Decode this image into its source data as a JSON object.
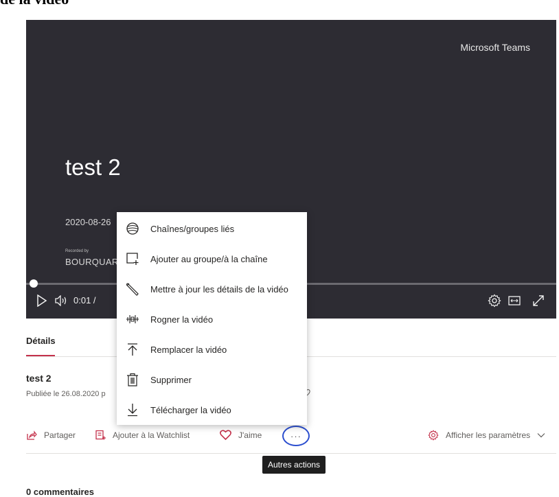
{
  "top_cut_text": "de la vidéo",
  "player": {
    "brand": "Microsoft Teams",
    "video_title": "test 2",
    "date": "2020-08-26",
    "recorded_by_label": "Recorded by",
    "recorder_name": "BOURQUAR",
    "time": "0:01 /"
  },
  "details": {
    "tab_label": "Détails",
    "title": "test 2",
    "published": "Publiée le 26.08.2020 p"
  },
  "actions": {
    "share": "Partager",
    "watchlist": "Ajouter à la Watchlist",
    "like": "J'aime",
    "more": "···",
    "settings": "Afficher les paramètres"
  },
  "tooltip": "Autres actions",
  "comments": "0 commentaires",
  "menu": {
    "items": [
      {
        "label": "Chaînes/groupes liés",
        "icon": "channels-icon"
      },
      {
        "label": "Ajouter au groupe/à la chaîne",
        "icon": "add-to-group-icon"
      },
      {
        "label": "Mettre à jour les détails de la vidéo",
        "icon": "edit-pencil-icon"
      },
      {
        "label": "Rogner la vidéo",
        "icon": "trim-icon"
      },
      {
        "label": "Remplacer la vidéo",
        "icon": "replace-upload-icon"
      },
      {
        "label": "Supprimer",
        "icon": "trash-icon"
      },
      {
        "label": "Télécharger la vidéo",
        "icon": "download-icon"
      }
    ]
  },
  "colors": {
    "player_bg": "#2d2c33",
    "accent_red": "#c4314b",
    "focus_blue": "#2b4ecf"
  }
}
